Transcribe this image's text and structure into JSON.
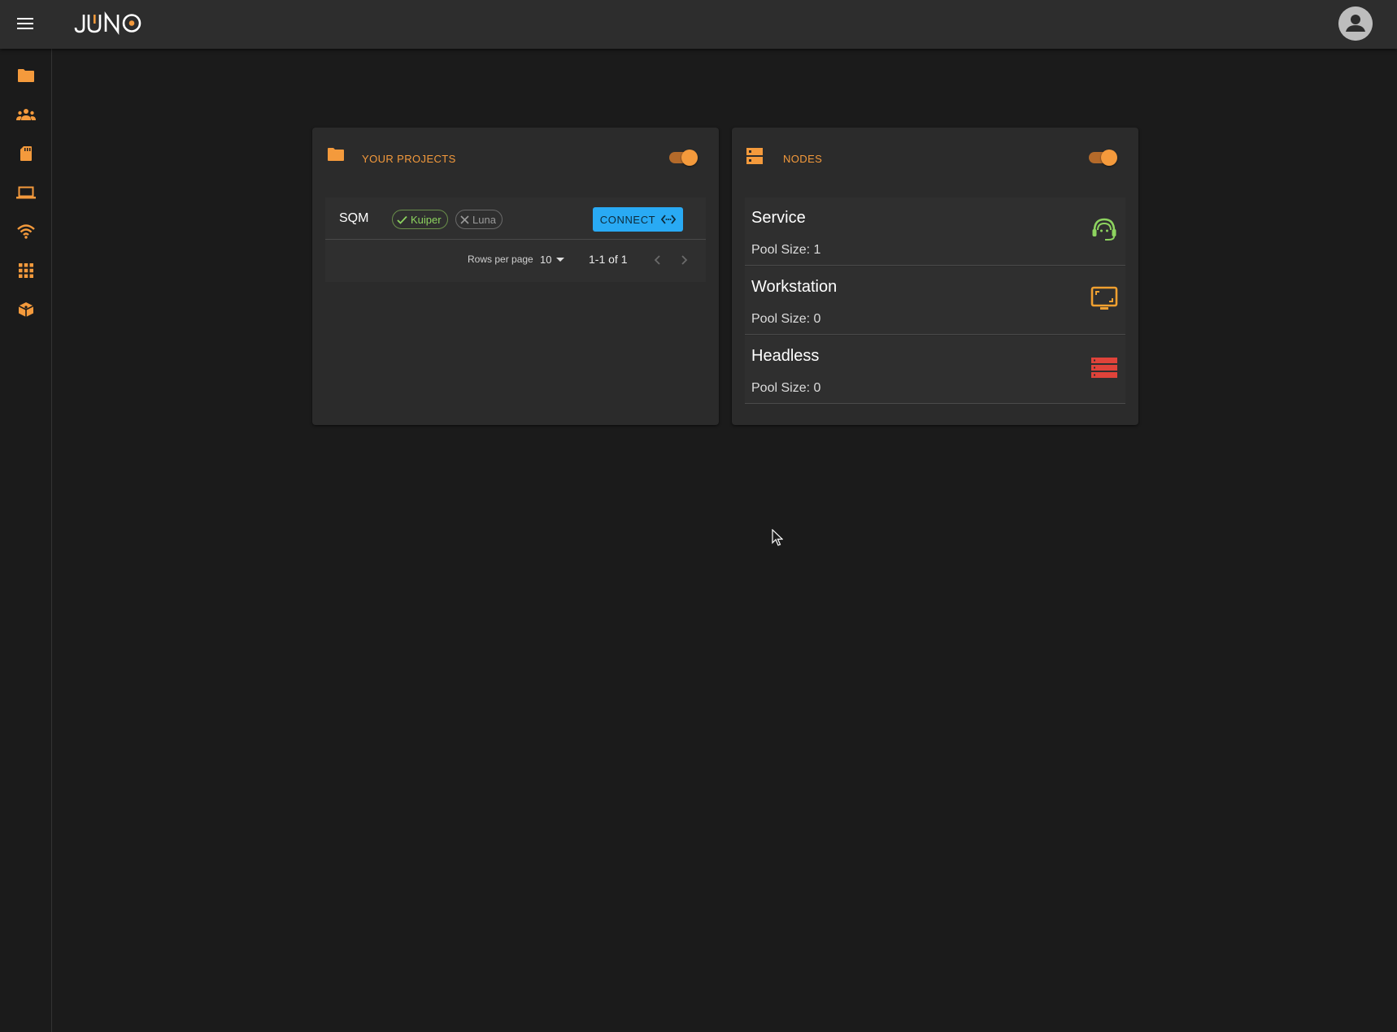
{
  "app": {
    "logo_text": "JUNO"
  },
  "colors": {
    "accent": "#f49a3c",
    "connect": "#29aaf4",
    "service_icon": "#8dd35f",
    "workstation_icon": "#f0a030",
    "headless_icon": "#e0433a"
  },
  "header": {
    "menu_icon": "hamburger-menu-icon",
    "avatar_icon": "account-circle-icon"
  },
  "sidebar": {
    "items": [
      {
        "icon": "folder-icon"
      },
      {
        "icon": "groups-icon"
      },
      {
        "icon": "sd-card-icon"
      },
      {
        "icon": "laptop-icon"
      },
      {
        "icon": "wifi-icon"
      },
      {
        "icon": "apps-grid-icon"
      },
      {
        "icon": "package-box-icon"
      }
    ]
  },
  "projects_card": {
    "title": "YOUR PROJECTS",
    "toggle_on": true,
    "rows": [
      {
        "name": "SQM",
        "chips": [
          {
            "label": "Kuiper",
            "state": "enabled"
          },
          {
            "label": "Luna",
            "state": "disabled"
          }
        ],
        "action_label": "CONNECT"
      }
    ],
    "pagination": {
      "rows_per_page_label": "Rows per page",
      "rows_per_page_value": "10",
      "range": "1-1 of 1"
    }
  },
  "nodes_card": {
    "title": "NODES",
    "toggle_on": true,
    "nodes": [
      {
        "name": "Service",
        "pool": "Pool Size: 1",
        "icon": "support-agent-icon"
      },
      {
        "name": "Workstation",
        "pool": "Pool Size: 0",
        "icon": "monitor-icon"
      },
      {
        "name": "Headless",
        "pool": "Pool Size: 0",
        "icon": "server-rack-icon"
      }
    ]
  }
}
